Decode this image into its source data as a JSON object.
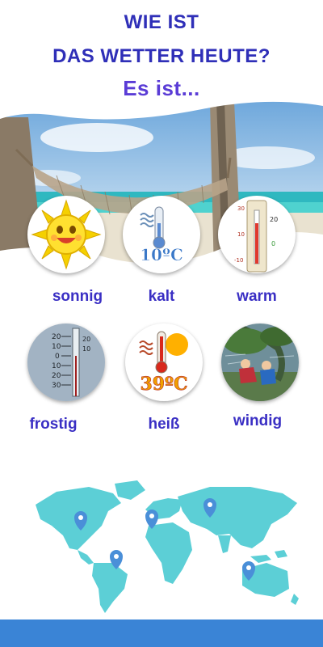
{
  "title": {
    "line1": "WIE IST",
    "line2": "DAS WETTER HEUTE?",
    "line3": "Es ist..."
  },
  "weather": [
    {
      "label": "sonnig",
      "icon": "sun-icon"
    },
    {
      "label": "kalt",
      "icon": "cold-thermometer-icon",
      "temp": "10ºC"
    },
    {
      "label": "warm",
      "icon": "warm-thermometer-icon",
      "scale": [
        "30",
        "20",
        "10",
        "0",
        "-10"
      ]
    },
    {
      "label": "frostig",
      "icon": "frosty-thermometer-icon",
      "scale": [
        "20",
        "10",
        "0",
        "10",
        "20",
        "30"
      ]
    },
    {
      "label": "heiß",
      "icon": "hot-thermometer-icon",
      "temp": "39ºC"
    },
    {
      "label": "windig",
      "icon": "windy-storm-icon"
    }
  ],
  "colors": {
    "heading": "#2f2fb8",
    "accent": "#5a3cd6",
    "map": "#5ccfd6",
    "pin": "#4a8fd8",
    "bottom_bar": "#3a84d6"
  }
}
